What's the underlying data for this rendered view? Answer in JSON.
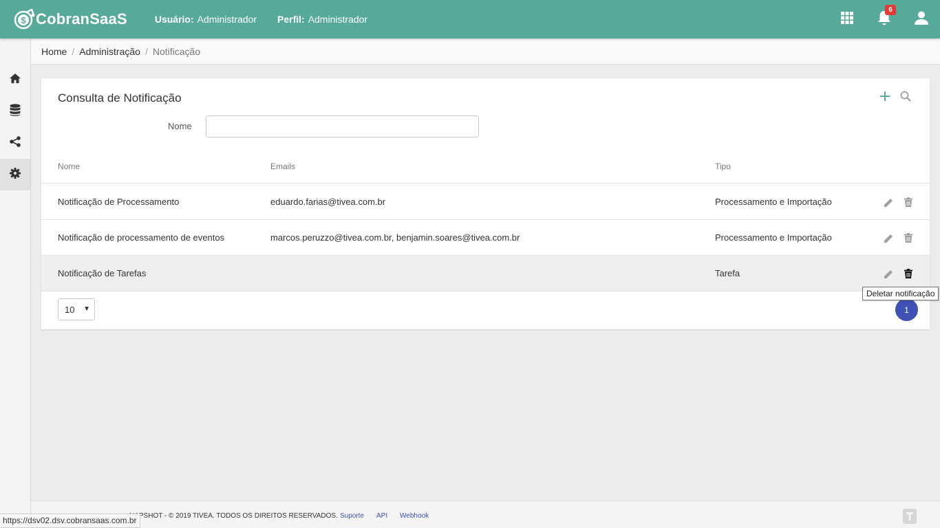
{
  "app": {
    "name": "CobranSaaS"
  },
  "header": {
    "user_label": "Usuário:",
    "user_value": "Administrador",
    "profile_label": "Perfil:",
    "profile_value": "Administrador",
    "notification_count": "6",
    "icons": [
      "apps-grid-icon",
      "bell-icon",
      "user-icon"
    ]
  },
  "sidebar": {
    "items": [
      {
        "icon": "home-icon",
        "active": false
      },
      {
        "icon": "database-icon",
        "active": false
      },
      {
        "icon": "share-icon",
        "active": false
      },
      {
        "icon": "gear-icon",
        "active": true
      }
    ]
  },
  "breadcrumb": {
    "home": "Home",
    "admin": "Administração",
    "current": "Notificação",
    "separator": "/"
  },
  "card": {
    "title": "Consulta de Notificação",
    "filter_label": "Nome",
    "filter_value": ""
  },
  "table": {
    "headers": {
      "nome": "Nome",
      "emails": "Emails",
      "tipo": "Tipo"
    },
    "rows": [
      {
        "nome": "Notificação de Processamento",
        "emails": "eduardo.farias@tivea.com.br",
        "tipo": "Processamento e Importação"
      },
      {
        "nome": "Notificação de processamento de eventos",
        "emails": "marcos.peruzzo@tivea.com.br, benjamin.soares@tivea.com.br",
        "tipo": "Processamento e Importação"
      },
      {
        "nome": "Notificação de Tarefas",
        "emails": "",
        "tipo": "Tarefa"
      }
    ]
  },
  "pagination": {
    "page_size": "10",
    "current_page": "1"
  },
  "tooltip": {
    "text": "Deletar notificação"
  },
  "footer": {
    "copyright": "NAPSHOT - © 2019 TIVEA. TODOS OS DIREITOS RESERVADOS.",
    "links": [
      "Suporte",
      "API",
      "Webhook"
    ]
  },
  "status_url": "https://dsv02.dsv.cobransaas.com.br",
  "colors": {
    "primary": "#57a99a",
    "accent": "#3f51b5",
    "badge": "#e53935"
  }
}
